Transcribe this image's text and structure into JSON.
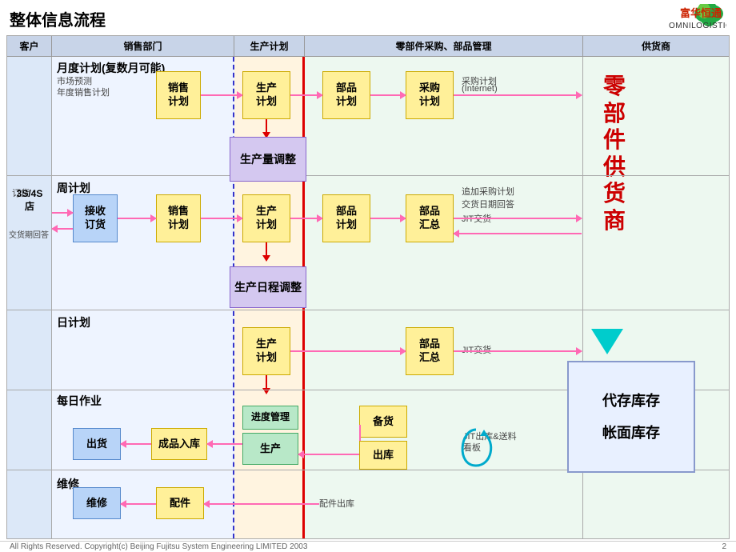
{
  "header": {
    "title": "整体信息流程",
    "logo_name": "富华恒通",
    "logo_sub": "OMNILOGISTICS"
  },
  "footer": {
    "page_num": "2",
    "copyright": "All Rights Reserved. Copyright(c) Beijing Fujitsu System Engineering LIMITED 2003"
  },
  "columns": {
    "customer": "客户",
    "sales": "销售部门",
    "production": "生产计划",
    "parts": "零部件采购、部品管理",
    "supplier": "供货商"
  },
  "sections": {
    "monthly": {
      "label": "月度计划(复数月可能)",
      "sub1": "市场预测",
      "sub2": "年度销售计划"
    },
    "weekly": {
      "label": "周计划"
    },
    "daily": {
      "label": "日计划"
    },
    "ops": {
      "label": "每日作业"
    },
    "repair": {
      "label": "维修"
    }
  },
  "boxes": {
    "sales_plan1": "销售\n计划",
    "prod_plan_m": "生产\n计划",
    "parts_plan_m": "部品\n计划",
    "purchase_plan": "采购\n计划",
    "purchase_plan_label": "采购计划",
    "internet_label": "(Internet)",
    "prod_volume_adj": "生产量调整",
    "receive_order": "接收\n订货",
    "sales_plan2": "销售\n计划",
    "prod_plan_w": "生产\n计划",
    "parts_plan_w": "部品\n计划",
    "parts_summary_w": "部品\n汇总",
    "add_purchase": "追加采购计划",
    "delivery_reply": "交货日期回答",
    "jit_delivery1": "JIT交货",
    "prod_schedule_adj": "生产日程调整",
    "prod_plan_d": "生产\n计划",
    "parts_summary_d": "部品\n汇总",
    "jit_delivery2": "JIT交货",
    "progress_mgmt": "进度管理",
    "stock_prep": "备货",
    "ship_out": "出货",
    "finished_in": "成品入库",
    "production": "生产",
    "warehouse_out": "出库",
    "jit_kanban": "JIT出库&送料\n看板",
    "repair_label": "维修",
    "parts_out": "配件出库",
    "parts_spare": "配件",
    "storage_box1": "代存库存",
    "storage_box2": "帐面库存",
    "zero_parts": "零\n部\n件\n供\n货\n商",
    "3s4s": "3S/4S\n店",
    "order": "订货",
    "delivery_return": "交货期回答"
  }
}
